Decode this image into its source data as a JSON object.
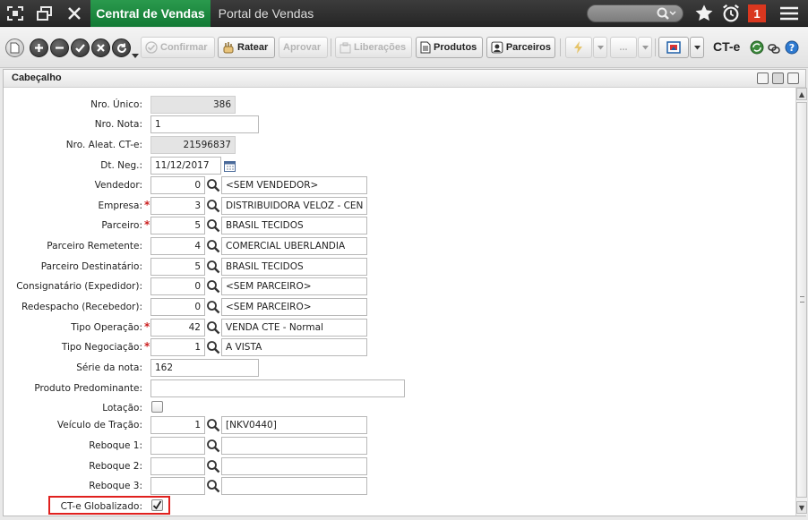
{
  "topbar": {
    "tabs": [
      {
        "label": "Central de Vendas",
        "active": true
      },
      {
        "label": "Portal de Vendas",
        "active": false
      }
    ],
    "notification_count": "1",
    "accent": "#1a8a3f",
    "notification_color": "#d9371f"
  },
  "toolbar": {
    "buttons": {
      "confirmar": "Confirmar",
      "ratear": "Ratear",
      "aprovar": "Aprovar",
      "liberacoes": "Liberações",
      "produtos": "Produtos",
      "parceiros": "Parceiros",
      "more": "..."
    },
    "module_label": "CT-e"
  },
  "panel": {
    "title": "Cabeçalho"
  },
  "form": {
    "nro_unico": {
      "label": "Nro. Único:",
      "value": "386"
    },
    "nro_nota": {
      "label": "Nro. Nota:",
      "value": "1"
    },
    "nro_aleat": {
      "label": "Nro. Aleat. CT-e:",
      "value": "21596837"
    },
    "dt_neg": {
      "label": "Dt. Neg.:",
      "value": "11/12/2017"
    },
    "vendedor": {
      "label": "Vendedor:",
      "code": "0",
      "desc": "<SEM VENDEDOR>"
    },
    "empresa": {
      "label": "Empresa:",
      "code": "3",
      "desc": "DISTRIBUIDORA VELOZ - CEN",
      "required": true
    },
    "parceiro": {
      "label": "Parceiro:",
      "code": "5",
      "desc": "BRASIL TECIDOS",
      "required": true
    },
    "parceiro_remetente": {
      "label": "Parceiro Remetente:",
      "code": "4",
      "desc": "COMERCIAL UBERLANDIA"
    },
    "parceiro_destinatario": {
      "label": "Parceiro Destinatário:",
      "code": "5",
      "desc": "BRASIL TECIDOS"
    },
    "consignatario": {
      "label": "Consignatário (Expedidor):",
      "code": "0",
      "desc": "<SEM PARCEIRO>"
    },
    "redespacho": {
      "label": "Redespacho (Recebedor):",
      "code": "0",
      "desc": "<SEM PARCEIRO>"
    },
    "tipo_operacao": {
      "label": "Tipo Operação:",
      "code": "42",
      "desc": "VENDA CTE - Normal",
      "required": true
    },
    "tipo_negociacao": {
      "label": "Tipo Negociação:",
      "code": "1",
      "desc": "A VISTA",
      "required": true
    },
    "serie_nota": {
      "label": "Série da nota:",
      "value": "162"
    },
    "produto_predominante": {
      "label": "Produto Predominante:",
      "value": ""
    },
    "lotacao": {
      "label": "Lotação:",
      "checked": false
    },
    "veiculo_tracao": {
      "label": "Veículo de Tração:",
      "code": "1",
      "desc": "[NKV0440]"
    },
    "reboque1": {
      "label": "Reboque 1:",
      "code": "",
      "desc": ""
    },
    "reboque2": {
      "label": "Reboque 2:",
      "code": "",
      "desc": ""
    },
    "reboque3": {
      "label": "Reboque 3:",
      "code": "",
      "desc": ""
    },
    "cte_globalizado": {
      "label": "CT-e Globalizado:",
      "checked": true
    },
    "highlight_color": "#e0201e"
  }
}
